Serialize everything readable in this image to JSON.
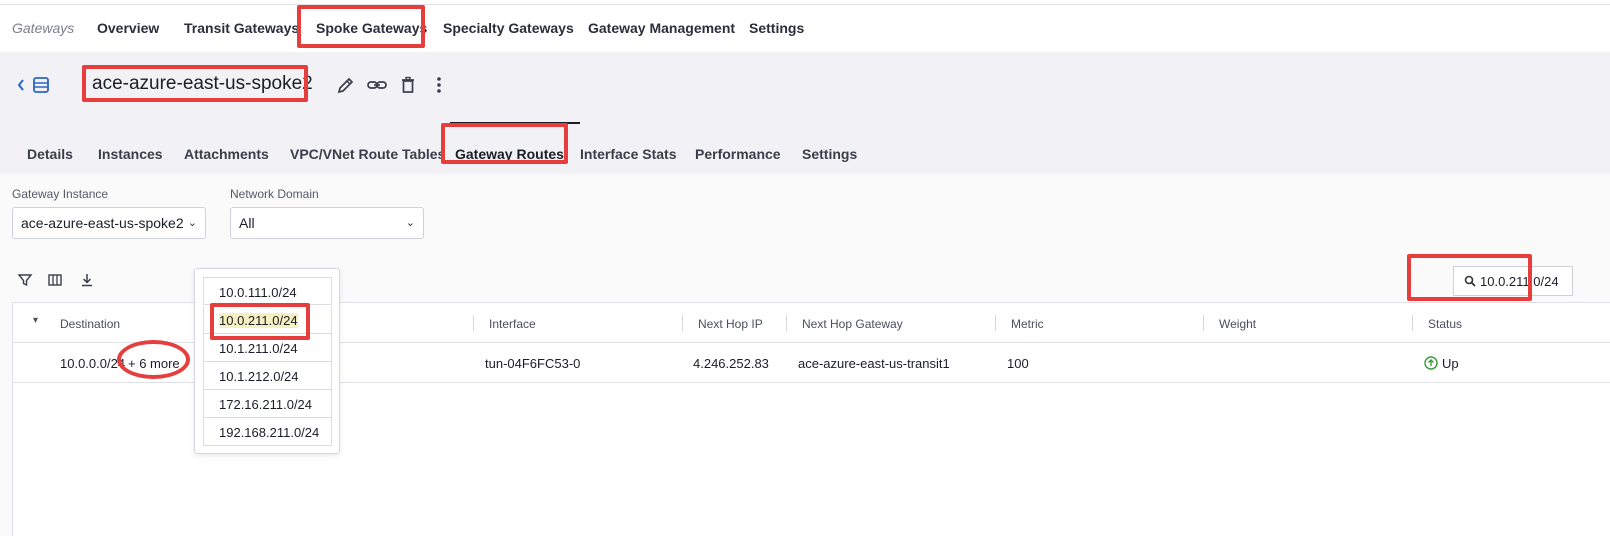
{
  "topnav": {
    "crumb": "Gateways",
    "items": [
      "Overview",
      "Transit Gateways",
      "Spoke Gateways",
      "Specialty Gateways",
      "Gateway Management",
      "Settings"
    ]
  },
  "gateway": {
    "name": "ace-azure-east-us-spoke2"
  },
  "tabs": [
    "Details",
    "Instances",
    "Attachments",
    "VPC/VNet Route Tables",
    "Gateway Routes",
    "Interface Stats",
    "Performance",
    "Settings"
  ],
  "filters": {
    "instance_label": "Gateway Instance",
    "instance_value": "ace-azure-east-us-spoke2",
    "domain_label": "Network Domain",
    "domain_value": "All"
  },
  "search": {
    "value": "10.0.211.0/24"
  },
  "table": {
    "columns": [
      "Destination",
      "Interface",
      "Next Hop IP",
      "Next Hop Gateway",
      "Metric",
      "Weight",
      "Status"
    ],
    "rows": [
      {
        "destination": "10.0.0.0/24",
        "more": "+ 6 more",
        "interface": "tun-04F6FC53-0",
        "next_hop_ip": "4.246.252.83",
        "next_hop_gateway": "ace-azure-east-us-transit1",
        "metric": "100",
        "weight": "",
        "status": "Up"
      }
    ]
  },
  "popup": {
    "items": [
      "10.0.111.0/24",
      "10.0.211.0/24",
      "10.1.211.0/24",
      "10.1.212.0/24",
      "172.16.211.0/24",
      "192.168.211.0/24"
    ]
  },
  "colors": {
    "highlight": "#e63d3d",
    "accent": "#2a64c4",
    "status_up": "#3a9a3a",
    "match": "#f6efc0"
  }
}
